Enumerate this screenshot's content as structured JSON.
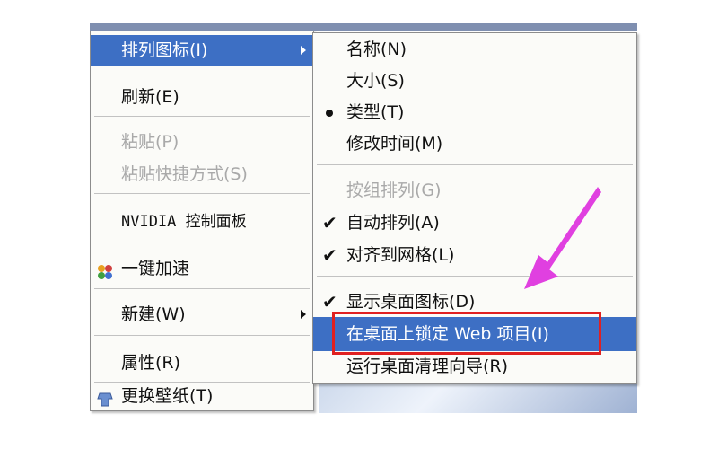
{
  "main_menu": {
    "items": [
      {
        "label": "排列图标(I)",
        "state": "selected",
        "submenu": true
      },
      {
        "label": "刷新(E)"
      },
      {
        "label": "粘贴(P)",
        "state": "disabled"
      },
      {
        "label": "粘贴快捷方式(S)",
        "state": "disabled"
      },
      {
        "label": "NVIDIA 控制面板"
      },
      {
        "label": "一键加速",
        "icon": "speedup-icon"
      },
      {
        "label": "新建(W)",
        "submenu": true
      },
      {
        "label": "属性(R)"
      },
      {
        "label": "更换壁纸(T)",
        "icon": "wallpaper-icon"
      }
    ]
  },
  "sub_menu": {
    "items": [
      {
        "label": "名称(N)"
      },
      {
        "label": "大小(S)"
      },
      {
        "label": "类型(T)",
        "mark": "bullet"
      },
      {
        "label": "修改时间(M)"
      },
      {
        "label": "按组排列(G)",
        "state": "disabled"
      },
      {
        "label": "自动排列(A)",
        "mark": "check"
      },
      {
        "label": "对齐到网格(L)",
        "mark": "check"
      },
      {
        "label": "显示桌面图标(D)",
        "mark": "check"
      },
      {
        "label": "在桌面上锁定 Web 项目(I)",
        "state": "selected"
      },
      {
        "label": "运行桌面清理向导(R)"
      }
    ]
  },
  "colors": {
    "selection": "#3d6fc4",
    "highlight_box": "#e02020",
    "arrow": "#e040e0"
  }
}
